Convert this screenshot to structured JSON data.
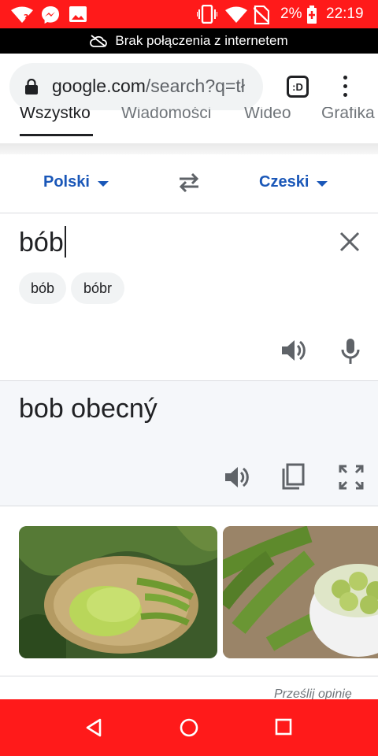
{
  "status_bar": {
    "battery_percent": "2%",
    "time": "22:19",
    "icons": [
      "wifi-question-icon",
      "messenger-icon",
      "gallery-icon",
      "vibrate-icon",
      "wifi-icon",
      "no-sim-icon",
      "battery-charging-icon"
    ]
  },
  "offline_banner": {
    "text": "Brak połączenia z internetem",
    "icon": "cloud-off-icon"
  },
  "browser": {
    "url_host": "google.com",
    "url_path": "/search?q=tł",
    "tab_count_label": ":D"
  },
  "search_tabs": [
    {
      "label": "Wszystko",
      "active": true
    },
    {
      "label": "Wiadomości",
      "active": false
    },
    {
      "label": "Wideo",
      "active": false
    },
    {
      "label": "Grafika",
      "active": false
    }
  ],
  "translate": {
    "source_lang": "Polski",
    "target_lang": "Czeski",
    "source_text": "bób",
    "suggestions": [
      "bób",
      "bóbr"
    ],
    "translation": "bob obecný"
  },
  "images": [
    {
      "alt": "bowl of fava beans"
    },
    {
      "alt": "fava beans in white bowl"
    }
  ],
  "feedback_link": "Prześlij opinię",
  "colors": {
    "status_bar": "#ff1a1a",
    "accent_blue": "#1a57b8",
    "navbar": "#ff1a1a"
  }
}
